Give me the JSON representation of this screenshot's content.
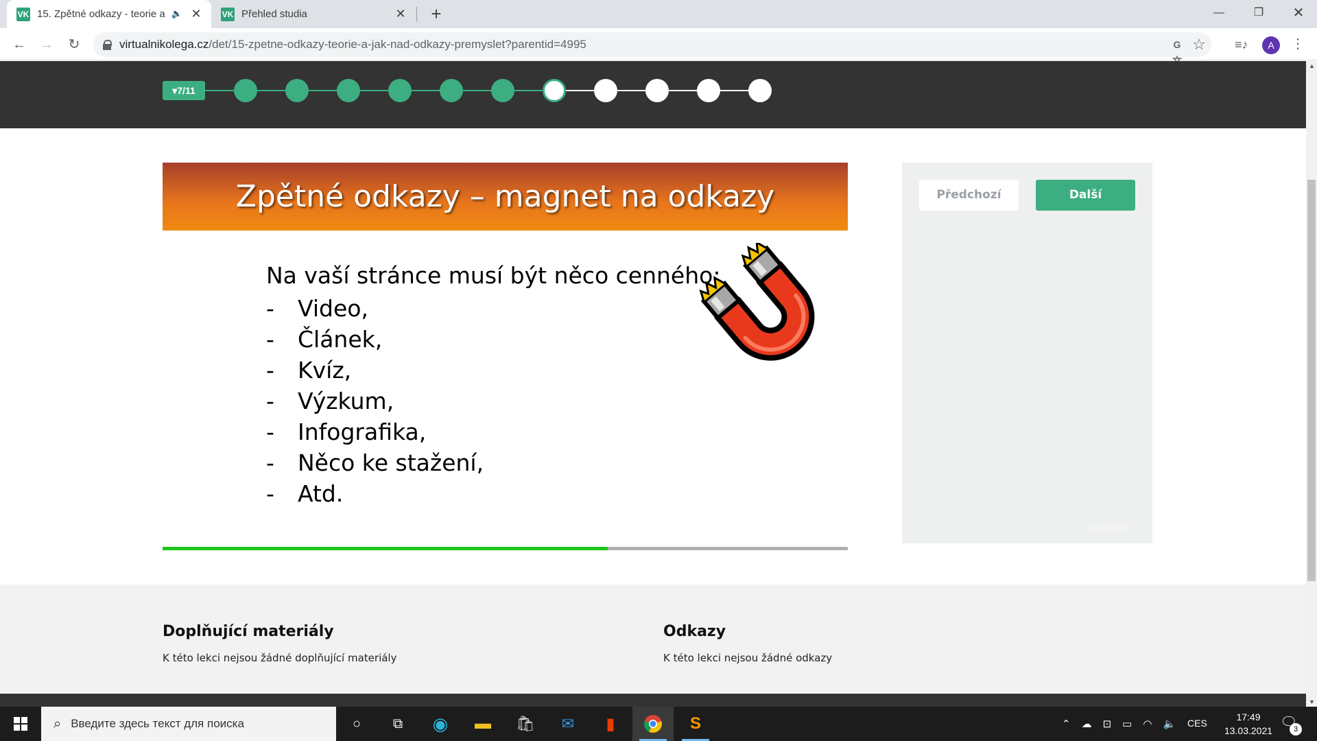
{
  "browser": {
    "tabs": [
      {
        "title": "15. Zpětné odkazy - teorie a",
        "favicon": "VK",
        "active": true,
        "audio": true
      },
      {
        "title": "Přehled studia",
        "favicon": "VK",
        "active": false
      }
    ],
    "url_host": "virtualnikolega.cz",
    "url_path": "/det/15-zpetne-odkazy-teorie-a-jak-nad-odkazy-premyslet?parentid=4995",
    "avatar_letter": "A",
    "icons": [
      "back-icon",
      "forward-icon",
      "reload-icon",
      "lock-icon",
      "translate-icon",
      "star-icon",
      "media-control-icon",
      "menu-icon",
      "minimize-icon",
      "maximize-icon",
      "close-icon"
    ]
  },
  "progress": {
    "badge": "7/11",
    "total": 11,
    "current": 7,
    "colors": {
      "done": "#3cae81",
      "todo": "#ffffff",
      "header_bg": "#333333"
    }
  },
  "slide": {
    "title": "Zpětné odkazy – magnet na odkazy",
    "intro": "Na vaší stránce musí být něco cenného:",
    "bullet": "-",
    "items": [
      "Video,",
      "Článek,",
      "Kvíz,",
      "Výzkum,",
      "Infografika,",
      "Něco ke stažení,",
      "Atd."
    ],
    "image": "magnet-icon",
    "video_progress": 0.65,
    "colors": {
      "title_bar": "#e8761c",
      "progress_fill": "#1ec31e"
    }
  },
  "side_panel": {
    "prev_label": "Předchozí",
    "next_label": "Další",
    "video_id": "VIDEO0680",
    "accent": "#3cae81"
  },
  "materials": {
    "supplementary": {
      "title": "Doplňující materiály",
      "text": "K této lekci nejsou žádné doplňující materiály"
    },
    "links": {
      "title": "Odkazy",
      "text": "K této lekci nejsou žádné odkazy"
    }
  },
  "taskbar": {
    "search_placeholder": "Введите здесь текст для поиска",
    "apps": [
      "cortana-icon",
      "task-view-icon",
      "edge-icon",
      "file-explorer-icon",
      "store-icon",
      "mail-icon",
      "office-icon",
      "chrome-icon",
      "sublime-text-icon"
    ],
    "language": "CES",
    "time": "17:49",
    "date": "13.03.2021",
    "notifications": "3"
  }
}
